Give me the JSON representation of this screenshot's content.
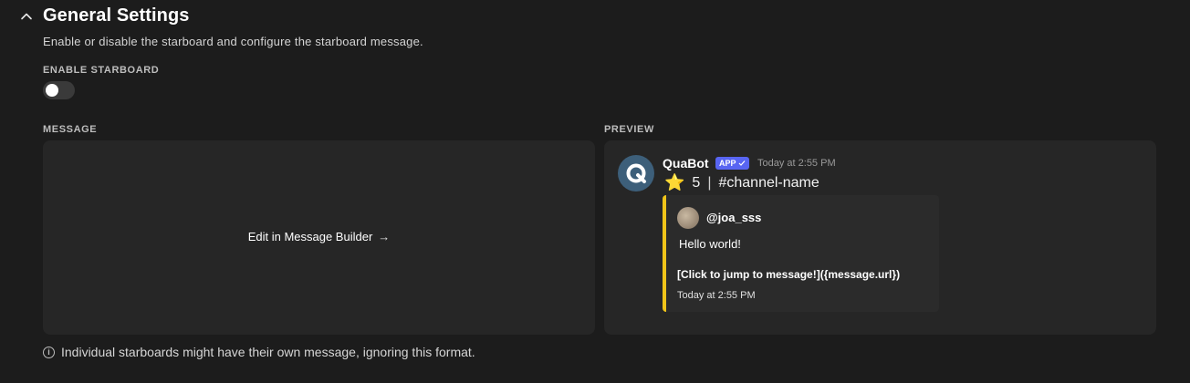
{
  "section": {
    "title": "General Settings",
    "description": "Enable or disable the starboard and configure the starboard message.",
    "collapse_icon": "chevron-up-icon"
  },
  "enable": {
    "label": "ENABLE STARBOARD",
    "enabled": false
  },
  "message": {
    "label": "MESSAGE",
    "edit_label": "Edit in Message Builder",
    "edit_arrow": "→"
  },
  "preview": {
    "label": "PREVIEW",
    "bot_name": "QuaBot",
    "badge": "APP",
    "timestamp": "Today at 2:55 PM",
    "star_emoji": "⭐",
    "star_count": "5",
    "separator": "|",
    "channel": "#channel-name",
    "embed": {
      "author": "@joa_sss",
      "description": "Hello world!",
      "link_text": "[Click to jump to message!]({message.url})",
      "footer": "Today at 2:55 PM",
      "accent_color": "#f0c419"
    }
  },
  "note": {
    "text": "Individual starboards might have their own message, ignoring this format.",
    "icon": "info-icon"
  },
  "colors": {
    "background": "#1c1c1c",
    "panel": "#262626",
    "badge": "#5865f2"
  }
}
